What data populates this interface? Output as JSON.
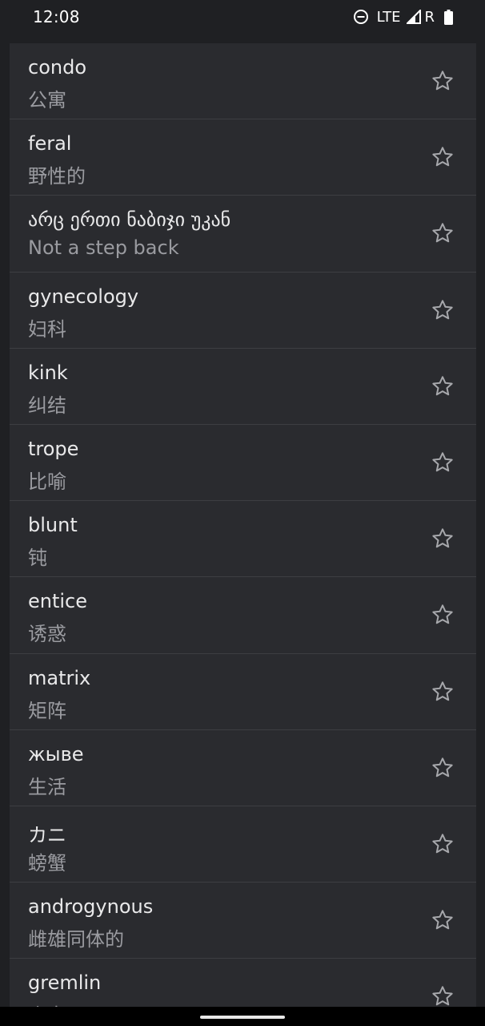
{
  "status_bar": {
    "time": "12:08",
    "network": "LTE",
    "roaming": "R"
  },
  "words": [
    {
      "term": "condo",
      "translation": "公寓"
    },
    {
      "term": "feral",
      "translation": "野性的"
    },
    {
      "term": "არც ერთი ნაბიჯი უკან",
      "translation": "Not a step back"
    },
    {
      "term": "gynecology",
      "translation": "妇科"
    },
    {
      "term": "kink",
      "translation": "纠结"
    },
    {
      "term": "trope",
      "translation": "比喻"
    },
    {
      "term": "blunt",
      "translation": "钝"
    },
    {
      "term": "entice",
      "translation": "诱惑"
    },
    {
      "term": "matrix",
      "translation": "矩阵"
    },
    {
      "term": "жыве",
      "translation": "生活"
    },
    {
      "term": "カニ",
      "translation": "螃蟹"
    },
    {
      "term": "androgynous",
      "translation": "雌雄同体的"
    },
    {
      "term": "gremlin",
      "translation": "小鬼"
    }
  ],
  "colors": {
    "background": "#1f2023",
    "card": "#2a2b2f",
    "divider": "#3d3e42",
    "term_text": "#e9e9ea",
    "translation_text": "#9a9ba0",
    "star_outline": "#a7a8ac"
  },
  "icons": {
    "favorite": "star-outline-icon",
    "dnd": "do-not-disturb-icon",
    "signal": "signal-icon",
    "battery": "battery-icon"
  }
}
